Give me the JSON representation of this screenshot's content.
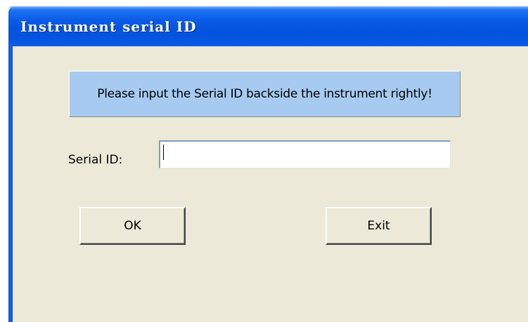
{
  "window": {
    "title": "Instrument serial ID"
  },
  "dialog": {
    "message": "Please input the Serial ID backside the instrument rightly!",
    "serial_label": "Serial ID:",
    "serial_value": "",
    "ok_label": "OK",
    "exit_label": "Exit"
  },
  "colors": {
    "titlebar": "#0454e0",
    "client_background": "#ece9d8",
    "message_background": "#a6caf0"
  }
}
